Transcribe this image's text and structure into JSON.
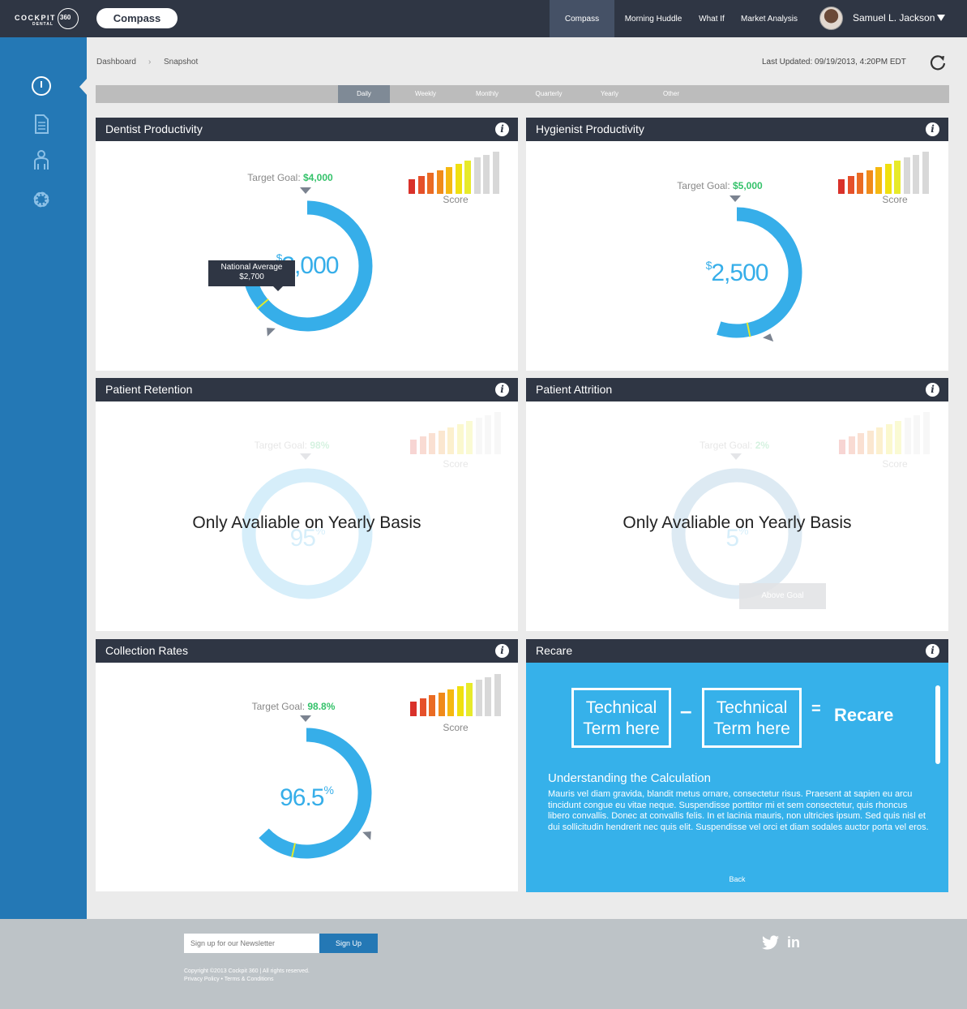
{
  "header": {
    "logo_text": "COCKPIT",
    "logo_sub": "DENTAL",
    "logo_num": "360",
    "app_name": "Compass",
    "nav": [
      "Compass",
      "Morning Huddle",
      "What If",
      "Market Analysis"
    ],
    "user_name": "Samuel L. Jackson"
  },
  "breadcrumb": [
    "Dashboard",
    "Snapshot"
  ],
  "last_updated": "Last Updated: 09/19/2013, 4:20PM EDT",
  "periods": [
    "Daily",
    "Weekly",
    "Monthly",
    "Quarterly",
    "Yearly",
    "Other"
  ],
  "active_period": "Daily",
  "score_label": "Score",
  "score_colors": [
    "#d9312a",
    "#e5502a",
    "#ea6b23",
    "#f08a1a",
    "#f5b811",
    "#f0e00f",
    "#e7ea2a",
    "#d8d8d8",
    "#d8d8d8",
    "#d8d8d8"
  ],
  "panels": {
    "dentist": {
      "title": "Dentist Productivity",
      "goal_label": "Target Goal:",
      "goal_value": "$4,000",
      "value_prefix": "$",
      "value": "3,000",
      "fraction": 0.75,
      "tooltip_title": "National Average",
      "tooltip_value": "$2,700"
    },
    "hygienist": {
      "title": "Hygienist Productivity",
      "goal_label": "Target Goal:",
      "goal_value": "$5,000",
      "value_prefix": "$",
      "value": "2,500",
      "fraction": 0.5
    },
    "retention": {
      "title": "Patient Retention",
      "goal_label": "Target Goal:",
      "goal_value": "98%",
      "value": "95",
      "unit": "%",
      "message": "Only Avaliable on Yearly Basis"
    },
    "attrition": {
      "title": "Patient Attrition",
      "goal_label": "Target Goal:",
      "goal_value": "2%",
      "value": "5",
      "unit": "%",
      "message": "Only Avaliable on Yearly Basis",
      "badge": "Above Goal"
    },
    "collection": {
      "title": "Collection Rates",
      "goal_label": "Target Goal:",
      "goal_value": "98.8%",
      "value": "96.5",
      "unit": "%",
      "fraction": 0.965
    },
    "recare": {
      "title": "Recare",
      "term1": "Technical Term here",
      "minus": "–",
      "term2": "Technical Term here",
      "equals": "=",
      "result": "Recare",
      "calc_title": "Understanding the Calculation",
      "calc_text": "Mauris vel diam gravida, blandit metus ornare, consectetur risus. Praesent at sapien eu arcu tincidunt congue eu vitae neque. Suspendisse porttitor mi et sem consectetur, quis rhoncus libero convallis. Donec at convallis felis. In et lacinia mauris, non ultricies ipsum. Sed quis nisl et dui sollicitudin hendrerit nec quis elit. Suspendisse vel orci et diam sodales auctor porta vel eros.",
      "back": "Back"
    }
  },
  "footer": {
    "newsletter_placeholder": "Sign up for our Newsletter",
    "signup": "Sign Up",
    "copyright": "Copyright ©2013 Cockpit 360  |  All rights reserved.",
    "links": "Privacy Policy  • Terms & Conditions"
  },
  "colors": {
    "dark": "#2f3644",
    "sidebar": "#2478b5",
    "gauge": "#36aee9",
    "goal": "#34c26a"
  }
}
